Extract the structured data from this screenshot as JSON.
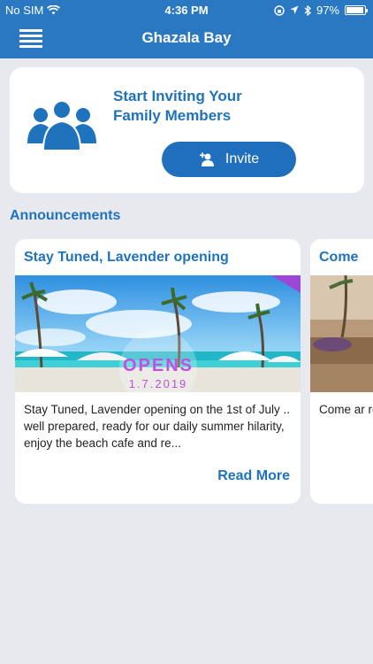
{
  "status_bar": {
    "carrier": "No SIM",
    "time": "4:36 PM",
    "battery": "97%",
    "battery_level": 0.97
  },
  "header": {
    "title": "Ghazala Bay",
    "menu_icon": "hamburger-menu-icon"
  },
  "invite_card": {
    "icon": "family-members-icon",
    "text": "Start Inviting Your Family Members",
    "button_label": "Invite",
    "button_icon": "add-user-icon"
  },
  "announcements": {
    "title": "Announcements",
    "items": [
      {
        "title": "Stay Tuned, Lavender opening",
        "image_text_1": "OPENS",
        "image_text_2": "1.7.2019",
        "body": "Stay Tuned, Lavender opening on the 1st of July .. well prepared, ready for our daily summer hilarity, enjoy the beach cafe and re...",
        "read_more": "Read More"
      },
      {
        "title": "Come",
        "body": "Come ar ready ar visitors,"
      }
    ]
  },
  "colors": {
    "header_bg": "#2a78c2",
    "accent": "#1f73bd",
    "background": "#e8e9ee"
  }
}
